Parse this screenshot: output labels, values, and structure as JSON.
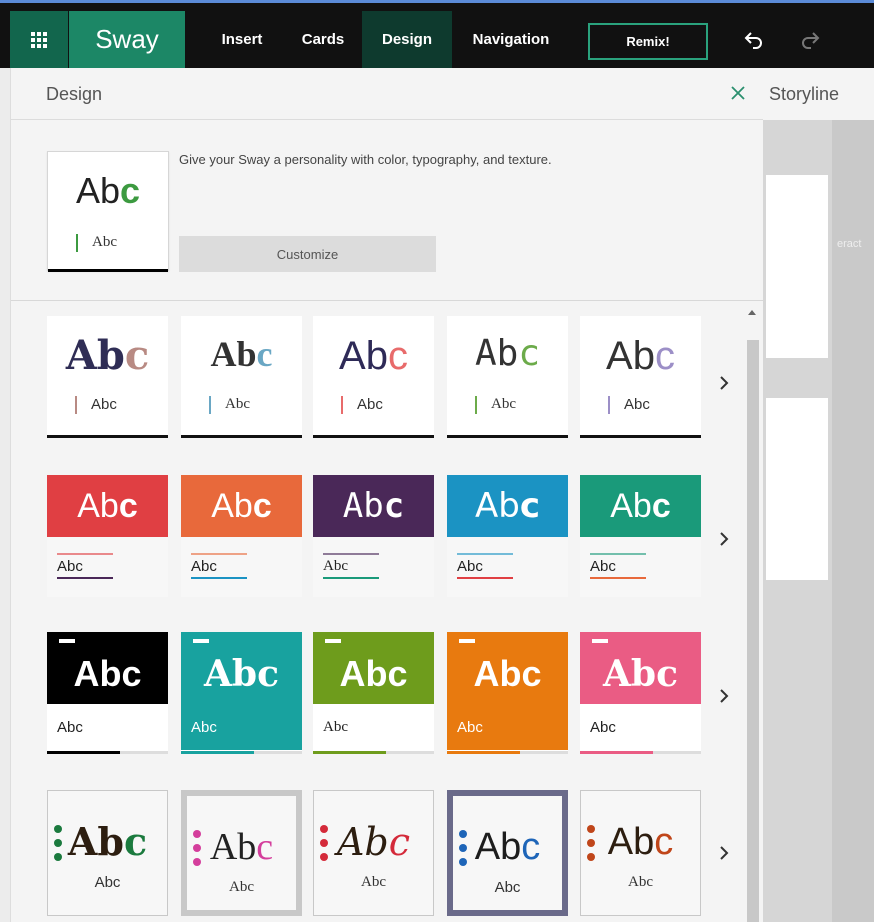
{
  "app": {
    "name": "Sway",
    "tabs": [
      "Insert",
      "Cards",
      "Design",
      "Navigation"
    ],
    "active_tab": "Design",
    "remix_label": "Remix!",
    "accent": "#1c8766"
  },
  "panel": {
    "title": "Design",
    "current_style": {
      "big": "Ab",
      "big_accent": "c",
      "small": "Abc"
    },
    "description": "Give your Sway a personality with color, typography, and texture.",
    "customize_label": "Customize"
  },
  "styles": {
    "big": "Abc",
    "small": "Abc",
    "row1_colors": [
      "#b88a83",
      "#6aa7c4",
      "#e86b6b",
      "#6cab4a",
      "#9c8fc7"
    ],
    "row2_colors": [
      "#e03f43",
      "#e8693b",
      "#4a2858",
      "#1b93c3",
      "#1a9a7a"
    ],
    "row3_colors": [
      "#000000",
      "#18a29f",
      "#6e9c1c",
      "#e87a0f",
      "#ea5c84"
    ],
    "row4_accents": [
      "#1b7a3e",
      "#d43e9c",
      "#d42a3a",
      "#1e65b8",
      "#c0461a"
    ]
  },
  "storyline": {
    "label": "Storyline",
    "fragment": "eract"
  }
}
